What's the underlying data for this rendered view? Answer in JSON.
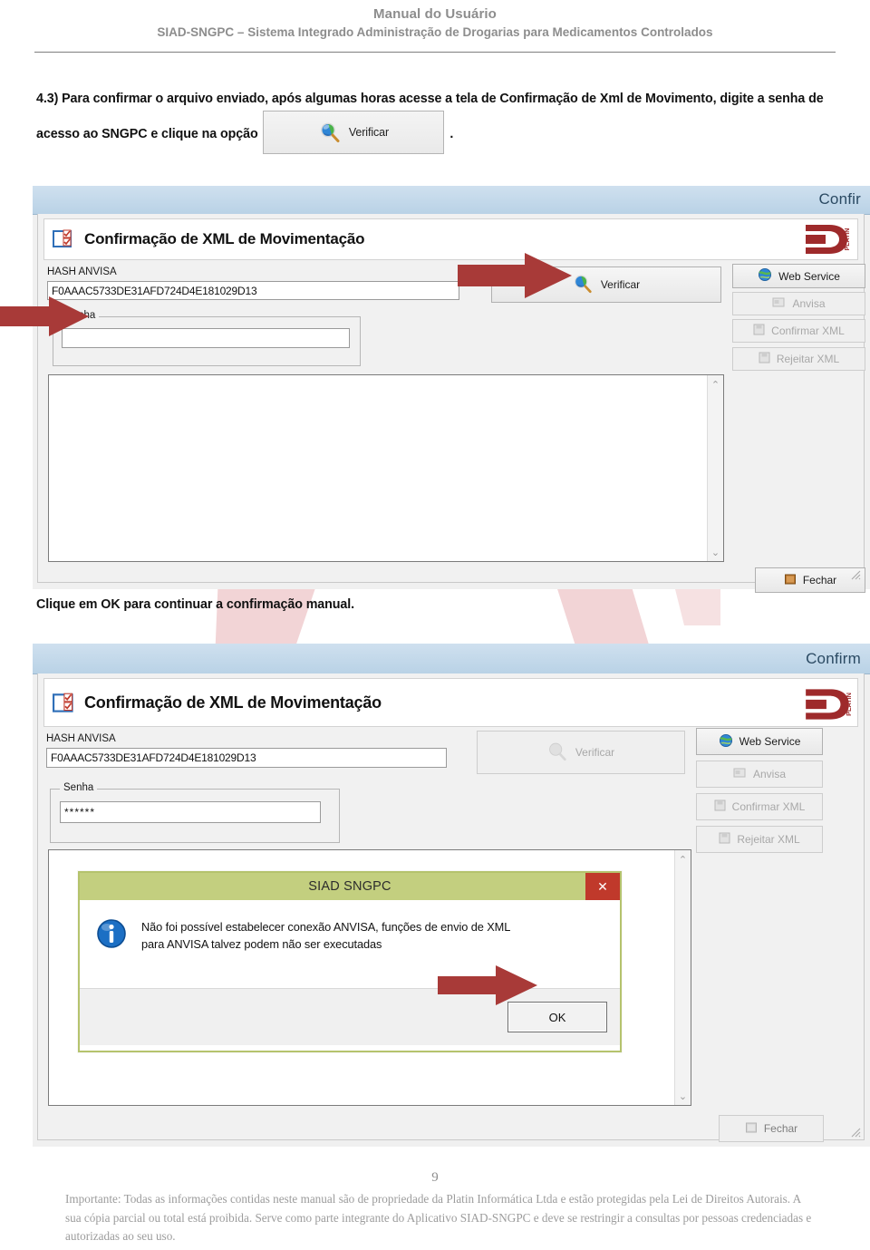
{
  "header": {
    "line1": "Manual do Usuário",
    "line2": "SIAD-SNGPC – Sistema Integrado Administração de Drogarias para Medicamentos Controlados"
  },
  "steps": {
    "step_43_part1": "4.3) Para confirmar o arquivo enviado, após algumas horas acesse a tela de Confirmação de Xml de Movimento, digite a senha de acesso ao SNGPC e clique na opção",
    "step_43_part2": ".",
    "inline_button_label": "Verificar",
    "ok_instruction": "Clique em OK para continuar a confirmação manual."
  },
  "screenshot1": {
    "window_title": "Confir",
    "form_title": "Confirmação de XML de Movimentação",
    "logo_text": "PLATIN",
    "hash_label": "HASH ANVISA",
    "hash_value": "F0AAAC5733DE31AFD724D4E181029D13",
    "senha_label": "Senha",
    "senha_value": "",
    "verificar_label": "Verificar",
    "side_buttons": [
      {
        "label": "Web Service",
        "enabled": true
      },
      {
        "label": "Anvisa",
        "enabled": false
      },
      {
        "label": "Confirmar XML",
        "enabled": false
      },
      {
        "label": "Rejeitar XML",
        "enabled": false
      }
    ],
    "fechar_label": "Fechar",
    "scroll_up": "⌃",
    "scroll_down": "⌄"
  },
  "screenshot2": {
    "window_title": "Confirm",
    "form_title": "Confirmação de XML de Movimentação",
    "logo_text": "PLATIN",
    "hash_label": "HASH ANVISA",
    "hash_value": "F0AAAC5733DE31AFD724D4E181029D13",
    "senha_label": "Senha",
    "senha_value": "******",
    "verificar_label": "Verificar",
    "side_buttons": [
      {
        "label": "Web Service",
        "enabled": true
      },
      {
        "label": "Anvisa",
        "enabled": false
      },
      {
        "label": "Confirmar XML",
        "enabled": false
      },
      {
        "label": "Rejeitar XML",
        "enabled": false
      }
    ],
    "fechar_label": "Fechar",
    "dialog": {
      "title": "SIAD SNGPC",
      "close_label": "✕",
      "message_line1": "Não foi possível estabelecer conexão ANVISA, funções de envio de XML",
      "message_line2": "para ANVISA talvez podem não ser executadas",
      "ok_label": "OK"
    }
  },
  "footer": {
    "page_number": "9",
    "notice": "Importante: Todas as informações contidas neste manual são de propriedade da Platin Informática Ltda e estão protegidas pela Lei de Direitos Autorais. A sua cópia parcial ou total está proibida. Serve como parte integrante do Aplicativo SIAD-SNGPC e deve se restringir a consultas por pessoas credenciadas e autorizadas ao seu uso."
  },
  "colors": {
    "arrow_red": "#a83a38",
    "title_gray": "#8d8d8d",
    "dialog_green": "#c3cf7f",
    "dialog_close_red": "#c0392b",
    "titlebar_blue": "#b9d2e6",
    "watermark_pink": "#f3d7d9"
  }
}
